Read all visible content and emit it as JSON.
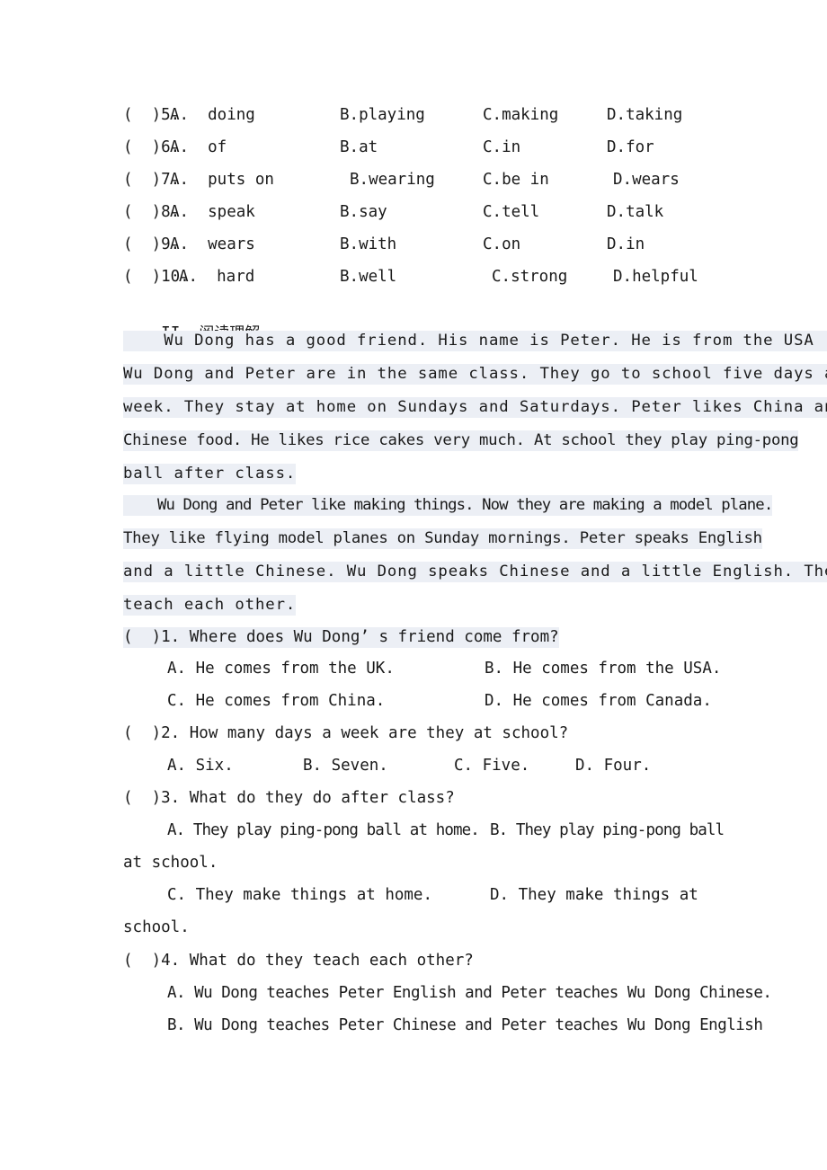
{
  "document": {
    "type": "english-exam-worksheet",
    "page_background": "#ffffff",
    "highlight_color": "#eceff5",
    "text_color": "#1a1a1a"
  },
  "cloze": {
    "rows": [
      {
        "num": "(  )5.",
        "a": "A.  doing",
        "b": "B.playing",
        "c": "C.making",
        "d": "D.taking"
      },
      {
        "num": "(  )6.",
        "a": "A.  of",
        "b": "B.at",
        "c": "C.in",
        "d": "D.for"
      },
      {
        "num": "(  )7.",
        "a": "A.  puts on",
        "b": "B.wearing",
        "c": "C.be in",
        "d": "D.wears"
      },
      {
        "num": "(  )8.",
        "a": "A.  speak",
        "b": "B.say",
        "c": "C.tell",
        "d": "D.talk"
      },
      {
        "num": "(  )9.",
        "a": "A.  wears",
        "b": "B.with",
        "c": "C.on",
        "d": "D.in"
      },
      {
        "num": "(  )10.",
        "a": "A.  hard",
        "b": "B.well",
        "c": "C.strong",
        "d": "D.helpful"
      }
    ]
  },
  "section": {
    "number": "II.",
    "title_cjk": "阅读理解"
  },
  "passage": {
    "paragraph1": [
      "    Wu Dong has a good friend. His name is Peter. He is from the USA .",
      "Wu Dong and Peter are in the same class. They go to school five days a",
      "week. They stay at home on Sundays and Saturdays. Peter likes China and",
      "Chinese food. He likes rice cakes very much. At school they play ping-pong",
      "ball after class."
    ],
    "paragraph2": [
      "    Wu Dong and Peter like making things. Now they are making a model plane.",
      "They like flying model planes on Sunday mornings. Peter speaks English",
      "and a little Chinese. Wu Dong speaks Chinese and a little English. They",
      "teach each other."
    ]
  },
  "questions": [
    {
      "stem": "(  )1. Where does Wu Dong’ s friend come from?",
      "highlighted": true,
      "options": [
        {
          "label": "A. He comes from the UK."
        },
        {
          "label": "B. He comes from the USA."
        },
        {
          "label": "C. He comes from China."
        },
        {
          "label": "D. He comes from Canada."
        }
      ]
    },
    {
      "stem": "(  )2. How many days a week are they at school?",
      "highlighted": false,
      "options": [
        {
          "label": "A. Six."
        },
        {
          "label": "B. Seven."
        },
        {
          "label": "C. Five."
        },
        {
          "label": "D. Four."
        }
      ]
    },
    {
      "stem": "(  )3. What do they do after class?",
      "highlighted": false,
      "options": [
        {
          "label": "A. They play ping-pong ball at home."
        },
        {
          "label": "B. They play ping-pong ball"
        },
        {
          "label": "at school."
        },
        {
          "label": "C. They make things at home."
        },
        {
          "label": "D. They make things at"
        },
        {
          "label": "school."
        }
      ]
    },
    {
      "stem": "(  )4. What do they teach each other?",
      "highlighted": false,
      "options": [
        {
          "label": "A. Wu Dong teaches Peter English and Peter teaches Wu Dong Chinese."
        },
        {
          "label": "B. Wu Dong teaches Peter Chinese and Peter teaches Wu Dong English"
        }
      ]
    }
  ]
}
